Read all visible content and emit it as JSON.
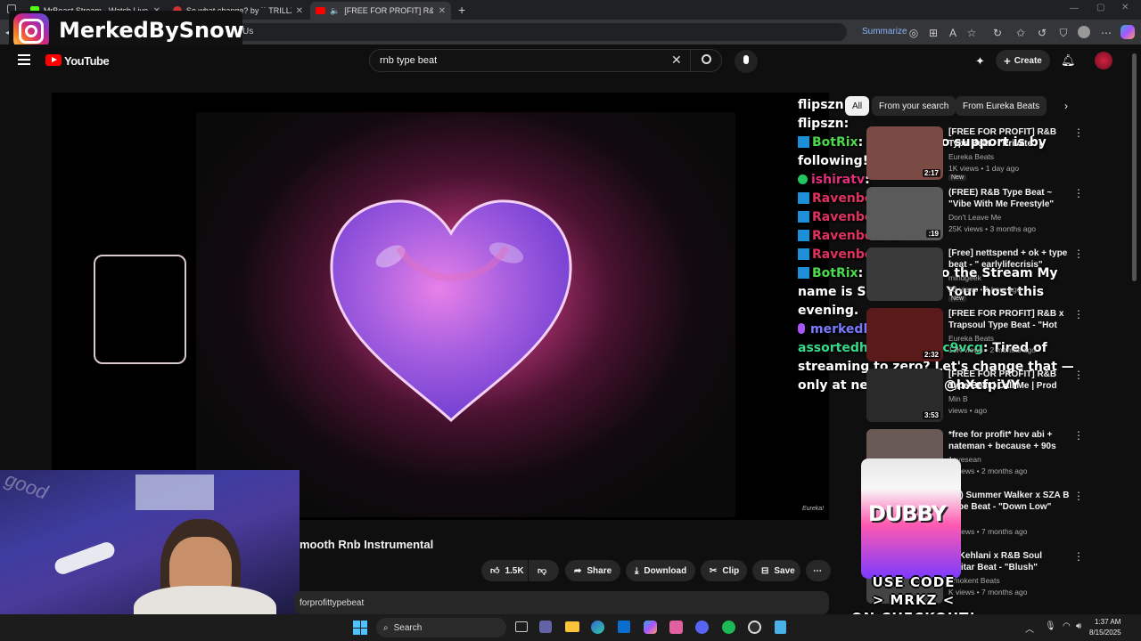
{
  "browser": {
    "tabs": [
      {
        "label": "MrBeast Stream - Watch Live on K",
        "icon": "kick-icon"
      },
      {
        "label": "So what change? by ˙˙ TRILLZ",
        "icon": "site-icon"
      },
      {
        "label": "[FREE FOR PROFIT] R&B Typ",
        "icon": "youtube-icon"
      }
    ],
    "address_fragment": "Us",
    "summarize_label": "Summarize"
  },
  "overlay": {
    "instagram_handle": "MerkedBySnow"
  },
  "youtube": {
    "logo_text": "YouTube",
    "search_value": "rnb type beat",
    "create_label": "Create"
  },
  "video": {
    "title_fragment": "mooth Rnb Instrumental",
    "likes": "1.5K",
    "share_label": "Share",
    "download_label": "Download",
    "clip_label": "Clip",
    "save_label": "Save",
    "description_fragment": "forprofittypebeat",
    "watermark": "Eureka!"
  },
  "chips": {
    "all": "All",
    "from_search": "From your search",
    "from_channel": "From Eureka Beats"
  },
  "recommendations": [
    {
      "title": "[FREE FOR PROFIT] R&B Type Beat - \"Private\" | Smooth Rnb",
      "channel": "Eureka Beats",
      "meta": "1K views • 1 day ago",
      "badge": "New",
      "duration": "2:17",
      "color": "#7a4a44"
    },
    {
      "title": "(FREE) R&B Type Beat ~ \"Vibe With Me Freestyle\"",
      "channel": "Don't Leave Me",
      "meta": "25K views • 3 months ago",
      "badge": "",
      "duration": ":19",
      "color": "#5a5a5a"
    },
    {
      "title": "[Free] nettspend + ok + type beat - \" earlylifecrisis\"",
      "channel": "mindgeek",
      "meta": "23 views • 1 hour ago",
      "badge": "New",
      "duration": "",
      "color": "#3a3a3a"
    },
    {
      "title": "[FREE FOR PROFIT] R&B x Trapsoul Type Beat - \"Hot But ...",
      "channel": "Eureka Beats",
      "meta": "13K views • 2 months ago",
      "badge": "",
      "duration": "2:32",
      "color": "#5a1a1a"
    },
    {
      "title": "[FREE FOR PROFIT] R&B Type Beat | Call Me | Prod MinB",
      "channel": "Min B",
      "meta": "views • ago",
      "badge": "",
      "duration": "3:53",
      "color": "#2a2a2a"
    },
    {
      "title": "*free for profit* hev abi + nateman + because + 90s rnb ...",
      "channel": "1ayesean",
      "meta": "K views • 2 months ago",
      "badge": "",
      "duration": "",
      "color": "#6a5a56"
    },
    {
      "title": "EE) Summer Walker x SZA B Type Beat - \"Down Low\"",
      "channel": "ll",
      "meta": "K views • 7 months ago",
      "badge": "",
      "duration": "",
      "color": "#444"
    },
    {
      "title": "e) Kehlani x R&B Soul Guitar Beat - \"Blush\"",
      "channel": "Smokent Beats",
      "meta": "K views • 7 months ago",
      "badge": "",
      "duration": "",
      "color": "#444"
    }
  ],
  "chat": [
    {
      "user": "flipszn",
      "text": "",
      "color": "#ffffff",
      "badge": ""
    },
    {
      "user": "flipszn",
      "text": ":",
      "color": "#ffffff",
      "badge": ""
    },
    {
      "user": "BotRix",
      "text": ": Best way to support is by following!",
      "color": "#4cd94c",
      "badge": "bot"
    },
    {
      "user": "ishiratv",
      "text": ":",
      "color": "#e0307a",
      "badge": "verified"
    },
    {
      "user": "Ravenbear2",
      "text": ":",
      "color": "#e03060",
      "badge": "bot"
    },
    {
      "user": "Ravenbear2",
      "text": ":",
      "color": "#e03060",
      "badge": "bot"
    },
    {
      "user": "Ravenbear2",
      "text": ":",
      "color": "#e03060",
      "badge": "bot"
    },
    {
      "user": "Ravenbear2",
      "text": ":",
      "color": "#e03060",
      "badge": "bot"
    },
    {
      "user": "BotRix",
      "text": ": Welcome to the Stream My name is Snow, I'll be Your host this evening.",
      "color": "#4cd94c",
      "badge": "bot"
    },
    {
      "user": "merkedbysnow",
      "text": ":",
      "color": "#7a7aff",
      "badge": "mic"
    },
    {
      "user": "assortedharmonykmc9vcg",
      "text": ": Tired of streaming to zero? Let's change that — only at nezhna .com @hXcfpiVY",
      "color": "#39d98a",
      "badge": ""
    }
  ],
  "promo": {
    "can_brand": "DUBBY",
    "line1": "USE CODE",
    "line2": "> MRKZ <",
    "line3": "ON CHECKOUT!"
  },
  "taskbar": {
    "search_label": "Search",
    "time": "1:37 AM",
    "date": "8/15/2025"
  },
  "colors": {
    "accent": "#ff0000",
    "chat_bot": "#4cd94c",
    "chat_raven": "#e03060"
  }
}
